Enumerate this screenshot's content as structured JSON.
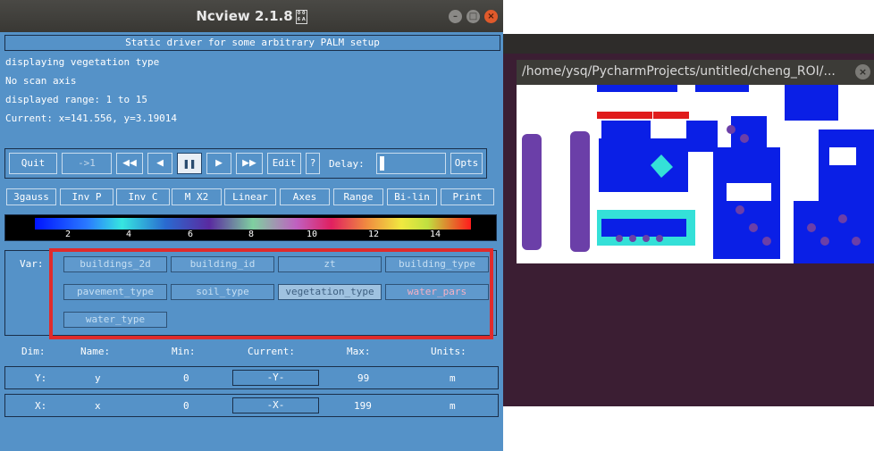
{
  "window": {
    "title": "Ncview 2.1.8",
    "controls": {
      "minimize": "–",
      "maximize": "□",
      "close": "×"
    }
  },
  "info": {
    "dataset_title": "Static driver for some arbitrary PALM setup",
    "line1": "displaying vegetation type",
    "line2": "No scan axis",
    "line3": "displayed range: 1 to 15",
    "line4": "Current: x=141.556, y=3.19014"
  },
  "toolbar": {
    "quit": "Quit",
    "step": "->1",
    "rewind": "◀◀",
    "back": "◀",
    "pause": "❚❚",
    "forward": "▶",
    "fastforward": "▶▶",
    "edit": "Edit",
    "help": "?",
    "delay_label": "Delay:",
    "opts": "Opts"
  },
  "options_row": [
    "3gauss",
    "Inv P",
    "Inv C",
    "M X2",
    "Linear",
    "Axes",
    "Range",
    "Bi-lin",
    "Print"
  ],
  "colorbar": {
    "ticks": [
      "2",
      "4",
      "6",
      "8",
      "10",
      "12",
      "14"
    ]
  },
  "variables": {
    "label": "Var:",
    "items": [
      "buildings_2d",
      "building_id",
      "zt",
      "building_type",
      "pavement_type",
      "soil_type",
      "vegetation_type",
      "water_pars",
      "water_type"
    ],
    "selected": "vegetation_type"
  },
  "dims": {
    "headers": {
      "dim": "Dim:",
      "name": "Name:",
      "min": "Min:",
      "current": "Current:",
      "max": "Max:",
      "units": "Units:"
    },
    "rows": [
      {
        "dim": "Y:",
        "name": "y",
        "min": "0",
        "current": "-Y-",
        "max": "99",
        "units": "m"
      },
      {
        "dim": "X:",
        "name": "x",
        "min": "0",
        "current": "-X-",
        "max": "199",
        "units": "m"
      }
    ]
  },
  "plot_window": {
    "title": "/home/ysq/PycharmProjects/untitled/cheng_ROI/...",
    "close": "×"
  },
  "colors": {
    "panel": "#5592c8",
    "highlight": "#e02b2b",
    "veg_purple": "#6b3fa8",
    "veg_blue": "#0a1fe6",
    "veg_cyan": "#34e0d8",
    "veg_red": "#e01c1c"
  }
}
